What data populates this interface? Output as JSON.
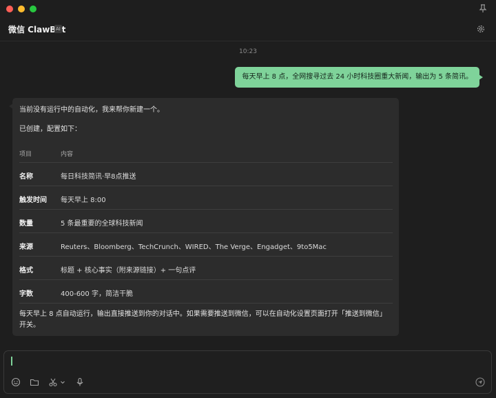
{
  "window": {
    "title": "微信 ClawBot",
    "badge": "AI"
  },
  "chat": {
    "timestamp": "10:23",
    "user_message": "每天早上 8 点，全网搜寻过去 24 小时科技圈重大新闻，输出为 5 条简讯。",
    "bot": {
      "intro": "当前没有运行中的自动化，我来帮你新建一个。",
      "created": "已创建，配置如下：",
      "table_headers": [
        "项目",
        "内容"
      ],
      "rows": [
        {
          "key": "名称",
          "value": "每日科技简讯·早8点推送"
        },
        {
          "key": "触发时间",
          "value": "每天早上 8:00"
        },
        {
          "key": "数量",
          "value": "5 条最重要的全球科技新闻"
        },
        {
          "key": "来源",
          "value": "Reuters、Bloomberg、TechCrunch、WIRED、The Verge、Engadget、9to5Mac"
        },
        {
          "key": "格式",
          "value": "标题 + 核心事实（附来源链接）+ 一句点评"
        },
        {
          "key": "字数",
          "value": "400-600 字，简洁干脆"
        }
      ],
      "footer": "每天早上 8 点自动运行，输出直接推送到你的对话中。如果需要推送到微信，可以在自动化设置页面打开「推送到微信」开关。"
    }
  },
  "composer": {
    "input_value": ""
  },
  "icons": {
    "window": [
      "close-button",
      "minimize-button",
      "zoom-button",
      "pin-icon",
      "gear-icon"
    ],
    "toolbar": [
      "emoji-icon",
      "folder-icon",
      "scissors-icon",
      "chevron-down-icon",
      "microphone-icon",
      "send-icon"
    ]
  },
  "colors": {
    "accent": "#7fd39a",
    "background": "#1e1e1e",
    "bubble": "#2c2c2c"
  }
}
